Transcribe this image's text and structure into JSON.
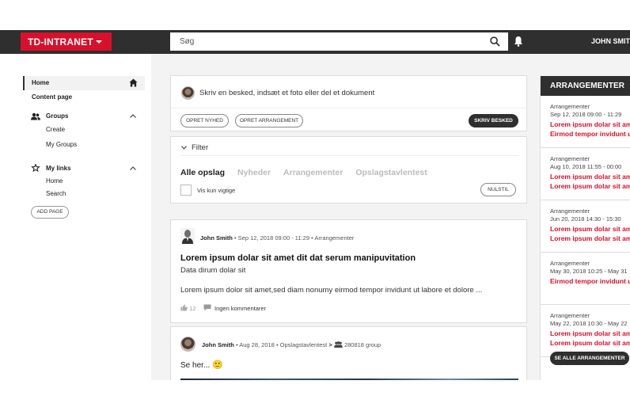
{
  "header": {
    "brand": "TD-INTRANET",
    "search_placeholder": "Søg",
    "user_name": "JOHN SMITH"
  },
  "sidebar": {
    "home": "Home",
    "content_page": "Content page",
    "groups_title": "Groups",
    "groups_items": [
      "Create",
      "My Groups"
    ],
    "links_title": "My links",
    "links_items": [
      "Home",
      "Search"
    ],
    "add_page": "ADD PAGE"
  },
  "composer": {
    "prompt": "Skriv en besked, indsæt et foto eller del et dokument",
    "btn_news": "OPRET NYHED",
    "btn_event": "OPRET ARRANGEMENT",
    "btn_submit": "SKRIV BESKED"
  },
  "filter": {
    "title": "Filter",
    "tabs": [
      "Alle opslag",
      "Nyheder",
      "Arrangementer",
      "Opslagstavlentest"
    ],
    "active_tab": 0,
    "important_only": "Vis kun vigtige",
    "reset": "NULSTIL"
  },
  "posts": [
    {
      "author": "John Smith",
      "meta": "• Sep 12, 2018 09:00 - 11:29 • Arrangementer",
      "title": "Lorem ipsum dolar sit amet dit dat serum manipuvitation",
      "subtitle": "Data dirum dolar sit",
      "body": "Lorem ipsum dolor sit amet,sed diam nonumy eirmod tempor invidunt ut labore et dolore ...",
      "likes": "12",
      "comments": "Ingen kommentarer"
    },
    {
      "author": "John Smith",
      "meta": "• Aug 28, 2018 • Opslagstavlentest",
      "group_sep": ">",
      "group": "280818 group",
      "body": "Se her...",
      "emoji": "🙂"
    }
  ],
  "events": {
    "title": "ARRANGEMENTER",
    "items": [
      {
        "type": "Arrangementer",
        "date": "Sep 12, 2018 09:00 - 11:29",
        "line1": "Lorem ipsum dolar sit amet",
        "line2": "Eirmod tempor invidunt ut labore"
      },
      {
        "type": "Arrangementer",
        "date": "Aug 10, 2018 11:55 - 00:00",
        "line1": "Lorem ipsum dolar sit amet",
        "line2": "Lorem ipsum dolar sit amet"
      },
      {
        "type": "Arrangementer",
        "date": "Jun 20, 2018 14:30 - 15:30",
        "line1": "Lorem ipsum dolar sit amet",
        "line2": "Lorem ipsum dolar sit amet"
      },
      {
        "type": "Arrangementer",
        "date": "May 30, 2018 10:25 - May 31",
        "line1": "Eirmod tempor invidunt ut labore",
        "line2": ""
      },
      {
        "type": "Arrangementer",
        "date": "May 22, 2018 10:30 - May 22",
        "line1": "Lorem ipsum dolar sit amet",
        "line2": "Lorem ipsum dolar sit amet"
      }
    ],
    "see_all": "SE ALLE ARRANGEMENTER"
  },
  "colors": {
    "accent": "#d8102c",
    "dark": "#2f2f2f",
    "background": "#f3f3f3"
  }
}
